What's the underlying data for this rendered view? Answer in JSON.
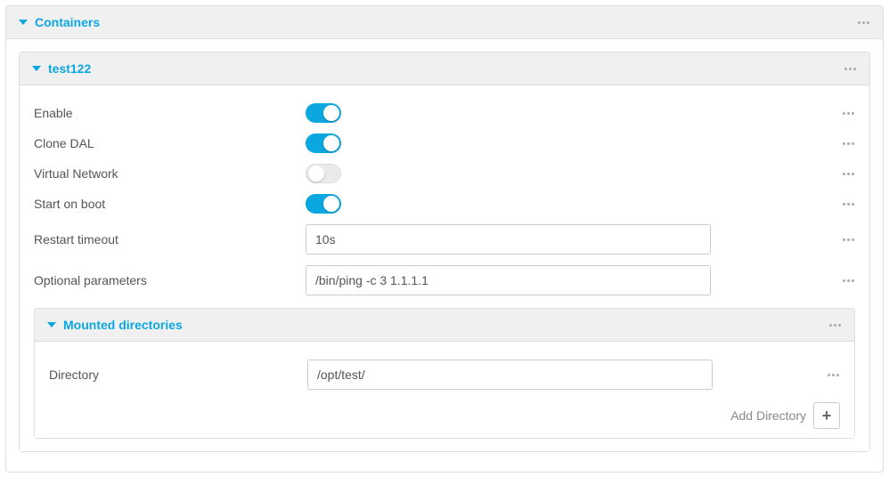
{
  "containers": {
    "title": "Containers"
  },
  "container": {
    "name": "test122",
    "fields": {
      "enable": {
        "label": "Enable",
        "value": true
      },
      "clone_dal": {
        "label": "Clone DAL",
        "value": true
      },
      "virtual_network": {
        "label": "Virtual Network",
        "value": false
      },
      "start_on_boot": {
        "label": "Start on boot",
        "value": true
      },
      "restart_timeout": {
        "label": "Restart timeout",
        "value": "10s"
      },
      "optional_parameters": {
        "label": "Optional parameters",
        "value": "/bin/ping -c 3 1.1.1.1"
      }
    },
    "mounted": {
      "title": "Mounted directories",
      "directory_label": "Directory",
      "directory_value": "/opt/test/",
      "add_label": "Add Directory"
    }
  }
}
